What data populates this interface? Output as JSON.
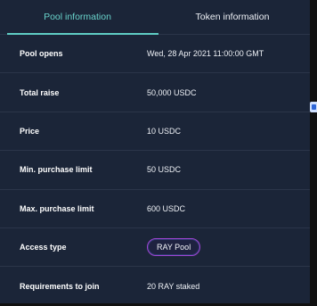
{
  "tabs": {
    "pool": "Pool information",
    "token": "Token information"
  },
  "pool_info": [
    {
      "label": "Pool opens",
      "value": "Wed, 28 Apr 2021 11:00:00 GMT"
    },
    {
      "label": "Total raise",
      "value": "50,000 USDC"
    },
    {
      "label": "Price",
      "value": "10 USDC"
    },
    {
      "label": "Min. purchase limit",
      "value": "50 USDC"
    },
    {
      "label": "Max. purchase limit",
      "value": "600 USDC"
    },
    {
      "label": "Access type",
      "value": "RAY Pool"
    },
    {
      "label": "Requirements to join",
      "value": "20 RAY staked"
    }
  ],
  "colors": {
    "active_tab": "#69d3cb",
    "pill_border": "#9f44d3",
    "panel_bg": "#1b2538"
  },
  "icons": {
    "side_badge": "side-extension-icon"
  }
}
